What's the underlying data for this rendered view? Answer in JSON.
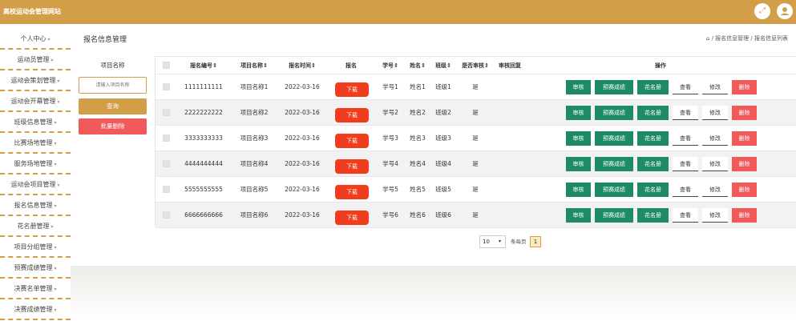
{
  "header": {
    "title": "高校运动会管理网站",
    "fullscreen_icon": "expand-icon",
    "user_icon": "user-icon"
  },
  "sidebar": {
    "items": [
      {
        "label": "个人中心"
      },
      {
        "label": "运动员管理"
      },
      {
        "label": "运动会策划管理"
      },
      {
        "label": "运动会开幕管理"
      },
      {
        "label": "班级信息管理"
      },
      {
        "label": "比赛场地管理"
      },
      {
        "label": "服务场地管理"
      },
      {
        "label": "运动会项目管理"
      },
      {
        "label": "报名信息管理"
      },
      {
        "label": "花名册管理"
      },
      {
        "label": "项目分组管理"
      },
      {
        "label": "预赛成绩管理"
      },
      {
        "label": "决赛名单管理"
      },
      {
        "label": "决赛成绩管理"
      }
    ]
  },
  "page": {
    "title": "报名信息管理",
    "breadcrumb": "/ 报名信息管理 / 报名信息列表"
  },
  "search": {
    "label": "项目名称",
    "placeholder": "请输入项目名称",
    "query_button": "查询",
    "batch_delete_button": "批量删除"
  },
  "table": {
    "headers": {
      "id": "报名编号",
      "project": "项目名称",
      "time": "报名时间",
      "signup": "报名",
      "student_no": "学号",
      "name": "姓名",
      "class": "班级",
      "approved": "是否审核",
      "reply": "审核回复",
      "actions": "操作"
    },
    "rows": [
      {
        "id": "1111111111",
        "project": "项目名称1",
        "time": "2022-03-16",
        "student_no": "学号1",
        "name": "姓名1",
        "class": "班级1",
        "approved": "是"
      },
      {
        "id": "2222222222",
        "project": "项目名称2",
        "time": "2022-03-16",
        "student_no": "学号2",
        "name": "姓名2",
        "class": "班级2",
        "approved": "是"
      },
      {
        "id": "3333333333",
        "project": "项目名称3",
        "time": "2022-03-16",
        "student_no": "学号3",
        "name": "姓名3",
        "class": "班级3",
        "approved": "是"
      },
      {
        "id": "4444444444",
        "project": "项目名称4",
        "time": "2022-03-16",
        "student_no": "学号4",
        "name": "姓名4",
        "class": "班级4",
        "approved": "是"
      },
      {
        "id": "5555555555",
        "project": "项目名称5",
        "time": "2022-03-16",
        "student_no": "学号5",
        "name": "姓名5",
        "class": "班级5",
        "approved": "是"
      },
      {
        "id": "6666666666",
        "project": "项目名称6",
        "time": "2022-03-16",
        "student_no": "学号6",
        "name": "姓名6",
        "class": "班级6",
        "approved": "是"
      }
    ],
    "buttons": {
      "download": "下载",
      "review": "审核",
      "prelim_score": "预赛成绩",
      "roster": "花名册",
      "view": "查看",
      "edit": "修改",
      "delete": "删除"
    }
  },
  "pagination": {
    "page_size": "10",
    "per_page_label": "条每页",
    "current_page": "1"
  },
  "colors": {
    "brand": "#d39e48",
    "danger": "#f05a5a",
    "success": "#1e8a66",
    "download": "#f23c1b"
  }
}
